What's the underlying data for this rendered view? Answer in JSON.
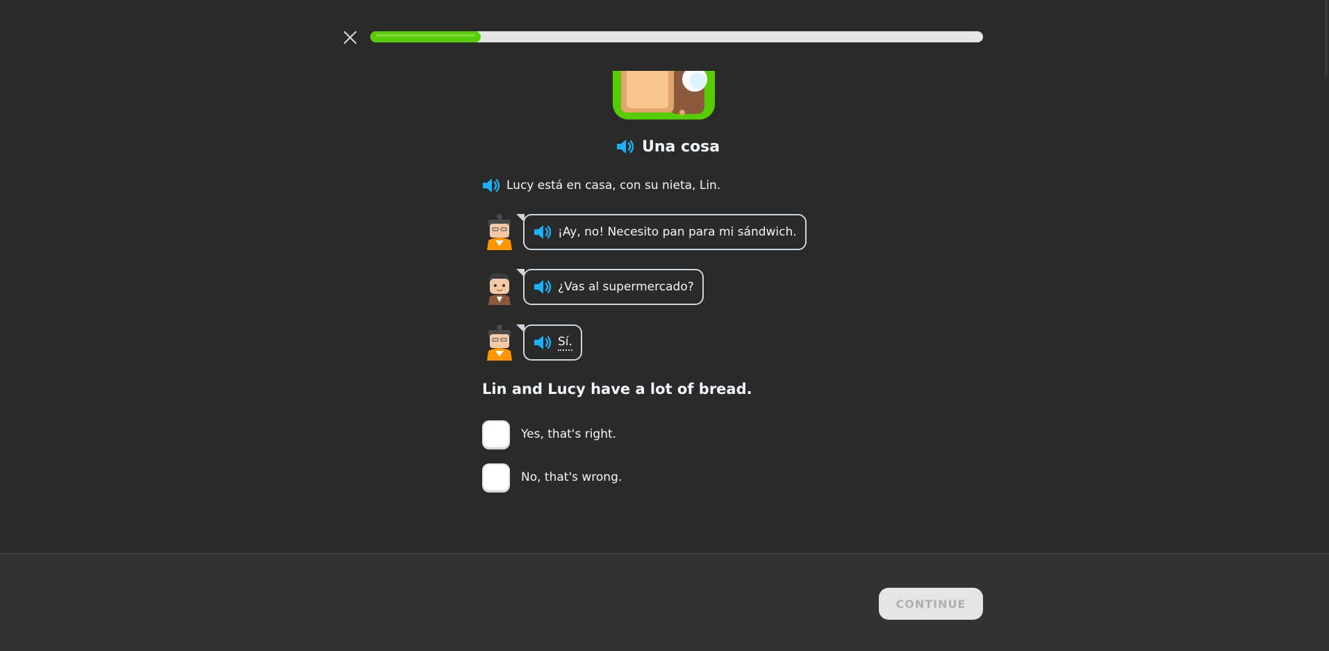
{
  "header": {
    "close_icon": "close-icon",
    "progress_percent": 18
  },
  "story": {
    "title": "Una cosa",
    "narration": "Lucy está en casa, con su nieta, Lin.",
    "lines": [
      {
        "speaker": "Lucy",
        "text": "¡Ay, no! Necesito pan para mi sándwich."
      },
      {
        "speaker": "Lin",
        "text": "¿Vas al supermercado?"
      },
      {
        "speaker": "Lucy",
        "text": "Sí."
      }
    ]
  },
  "question": {
    "prompt": "Lin and Lucy have a lot of bread.",
    "options": [
      "Yes, that's right.",
      "No, that's wrong."
    ]
  },
  "footer": {
    "continue_label": "CONTINUE"
  },
  "colors": {
    "background": "#2a2a2a",
    "progress_fill": "#58cc02",
    "speaker_blue": "#1cb0f6",
    "button_disabled": "#e5e5e5"
  }
}
